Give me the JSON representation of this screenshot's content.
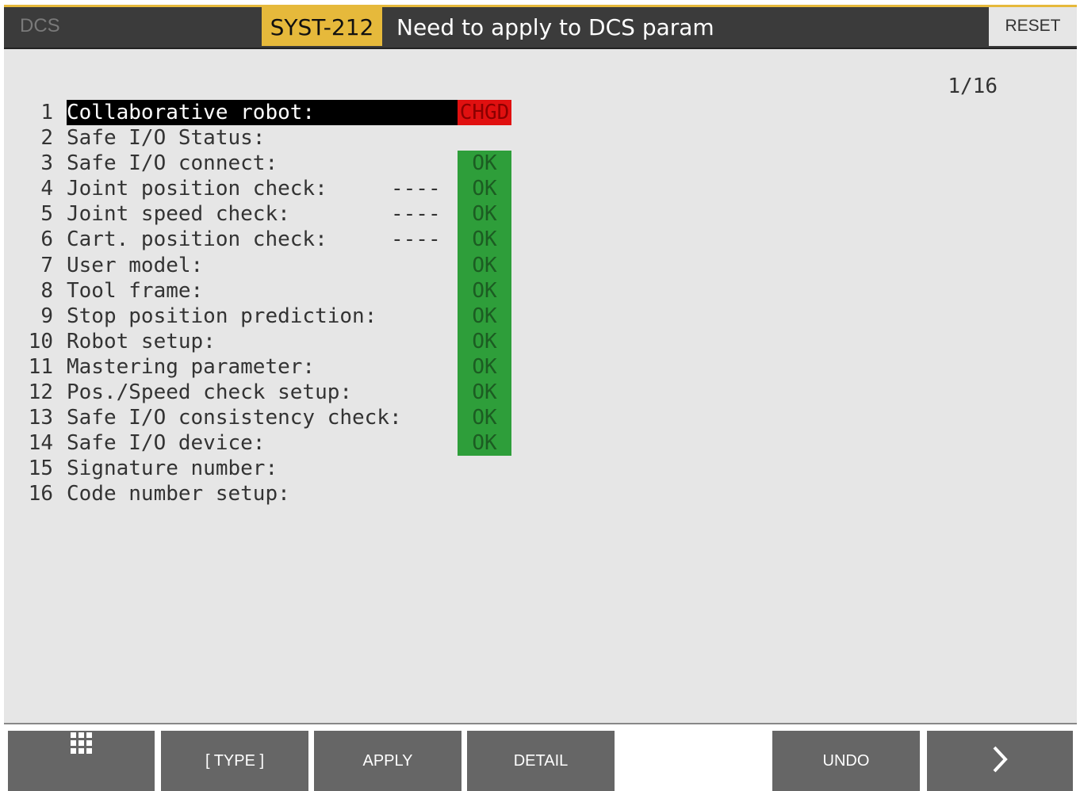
{
  "header": {
    "app_name": "DCS",
    "alarm_code": "SYST-212",
    "alarm_message": "Need to apply to DCS param",
    "reset_label": "RESET"
  },
  "colors": {
    "alarm_bg": "#e6b93b",
    "ok_bg": "#2e9e3a",
    "chgd_bg": "#e01010",
    "panel_bg": "#e6e6e6",
    "fkey_bg": "#666666"
  },
  "page_indicator": "1/16",
  "items": [
    {
      "num": "1",
      "label": "Collaborative robot:",
      "dash": "",
      "status": "CHGD"
    },
    {
      "num": "2",
      "label": "Safe I/O Status:",
      "dash": "",
      "status": ""
    },
    {
      "num": "3",
      "label": "Safe I/O connect:",
      "dash": "",
      "status": "OK"
    },
    {
      "num": "4",
      "label": "Joint position check:",
      "dash": "----",
      "status": "OK"
    },
    {
      "num": "5",
      "label": "Joint speed check:",
      "dash": "----",
      "status": "OK"
    },
    {
      "num": "6",
      "label": "Cart. position check:",
      "dash": "----",
      "status": "OK"
    },
    {
      "num": "7",
      "label": "User model:",
      "dash": "",
      "status": "OK"
    },
    {
      "num": "8",
      "label": "Tool frame:",
      "dash": "",
      "status": "OK"
    },
    {
      "num": "9",
      "label": "Stop position prediction:",
      "dash": "",
      "status": "OK"
    },
    {
      "num": "10",
      "label": "Robot setup:",
      "dash": "",
      "status": "OK"
    },
    {
      "num": "11",
      "label": "Mastering parameter:",
      "dash": "",
      "status": "OK"
    },
    {
      "num": "12",
      "label": "Pos./Speed check setup:",
      "dash": "",
      "status": "OK"
    },
    {
      "num": "13",
      "label": "Safe I/O consistency check:",
      "dash": "",
      "status": "OK"
    },
    {
      "num": "14",
      "label": "Safe I/O device:",
      "dash": "",
      "status": "OK"
    },
    {
      "num": "15",
      "label": "Signature number:",
      "dash": "",
      "status": ""
    },
    {
      "num": "16",
      "label": "Code number setup:",
      "dash": "",
      "status": ""
    }
  ],
  "function_keys": {
    "menu_icon": "grid-icon",
    "type_label": "[ TYPE ]",
    "apply_label": "APPLY",
    "detail_label": "DETAIL",
    "undo_label": "UNDO",
    "next_icon": "chevron-right-icon"
  }
}
